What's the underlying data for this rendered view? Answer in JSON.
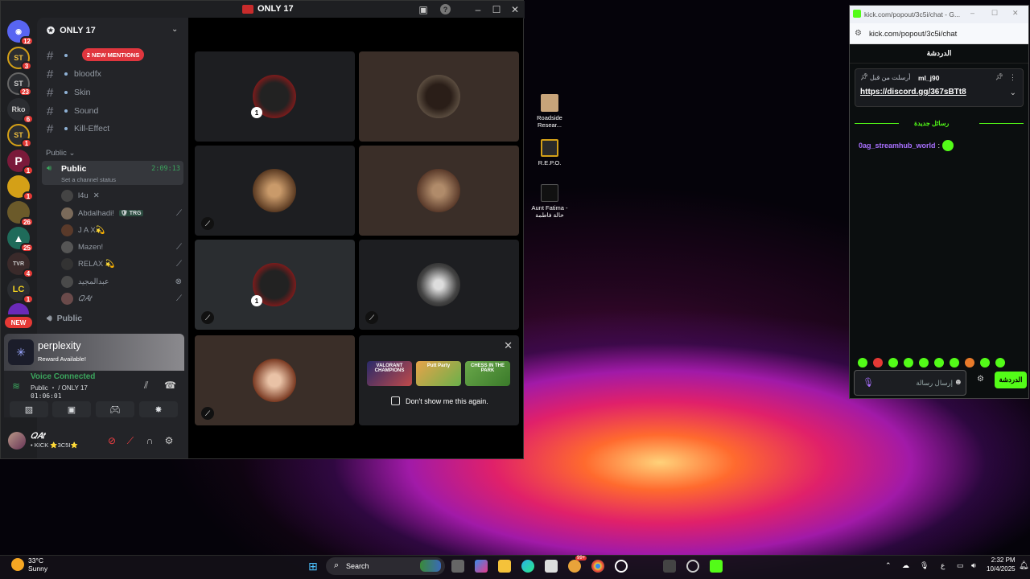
{
  "discord": {
    "window_title": "ONLY 17",
    "server_name": "ONLY 17",
    "servers": [
      {
        "label": "",
        "badge": "12",
        "color": "#5865f2"
      },
      {
        "label": "ST",
        "badge": "3",
        "color": "#2b2d31"
      },
      {
        "label": "ST",
        "badge": "23",
        "color": "#2b2d31"
      },
      {
        "label": "Rko",
        "badge": "6",
        "color": "#2b2d31"
      },
      {
        "label": "ST",
        "badge": "1",
        "color": "#2b2d31"
      },
      {
        "label": "P",
        "badge": "1",
        "color": "#7a1a3a"
      },
      {
        "label": "",
        "badge": "1",
        "color": "#d4a017"
      },
      {
        "label": "",
        "badge": "26",
        "color": "#6b5a2a"
      },
      {
        "label": "",
        "badge": "25",
        "color": "#1f6b5a"
      },
      {
        "label": "TVR",
        "badge": "4",
        "color": "#3a2a2a"
      },
      {
        "label": "LC",
        "badge": "1",
        "color": "#2b2d31"
      }
    ],
    "new_label": "NEW",
    "mentions_pill": "2 NEW MENTIONS",
    "channels": [
      "",
      "bloodfx",
      "Skin",
      "Sound",
      "Kill-Effect"
    ],
    "category": "Public",
    "voice_channel": {
      "name": "Public",
      "elapsed": "2:09:13",
      "status_placeholder": "Set a channel status"
    },
    "members": [
      {
        "name": "l4u",
        "extra": "✕",
        "icon": ""
      },
      {
        "name": "Abdalhadi!",
        "tag": "TRG",
        "icon": "mic-off"
      },
      {
        "name": "J A X💫",
        "icon": ""
      },
      {
        "name": "Mazen!",
        "icon": "mic-off"
      },
      {
        "name": "RELAX 💫",
        "icon": "mic-off"
      },
      {
        "name": "عبدالمجيد",
        "icon": "xbox"
      },
      {
        "name": "𝑄𝐴𝑡",
        "icon": "mic-off"
      }
    ],
    "second_voice": "Public",
    "promo": {
      "name": "perplexity",
      "sub": "Reward Available!"
    },
    "voice_connected": {
      "title": "Voice Connected",
      "channel": "Public ・ / ONLY 17",
      "time": "01:06:01"
    },
    "user": {
      "name": "𝑄𝐴𝑡",
      "status": "• KICK ⭐3C5I⭐"
    },
    "activity": {
      "dont_show": "Don't show me this again.",
      "games": [
        "VALORANT CHAMPIONS",
        "Putt Party",
        "CHESS IN THE PARK"
      ]
    }
  },
  "desktop": [
    {
      "name": "Roadside Resear..."
    },
    {
      "name": "R.E.P.O."
    },
    {
      "name": "Aunt Fatima - خالة فاطمة"
    }
  ],
  "kick": {
    "tab_title": "kick.com/popout/3c5i/chat - G...",
    "url": "kick.com/popout/3c5i/chat",
    "header": "الدردشة",
    "pinned_by": "أرسلت من قبل",
    "pinned_user": "ml_j90",
    "pinned_link": "https://discord.gg/367sBTt8",
    "new_messages": "رسائل جديدة",
    "message_user": "0ag_streamhub_world",
    "input_placeholder": "إرسال رسالة",
    "send_label": "الدردشة",
    "accent": "#53fc18"
  },
  "taskbar": {
    "temp": "33°C",
    "weather": "Sunny",
    "search": "Search",
    "lang": "ع",
    "time": "2:32 PM",
    "date": "10/4/2025",
    "notif_badge": "99+"
  }
}
